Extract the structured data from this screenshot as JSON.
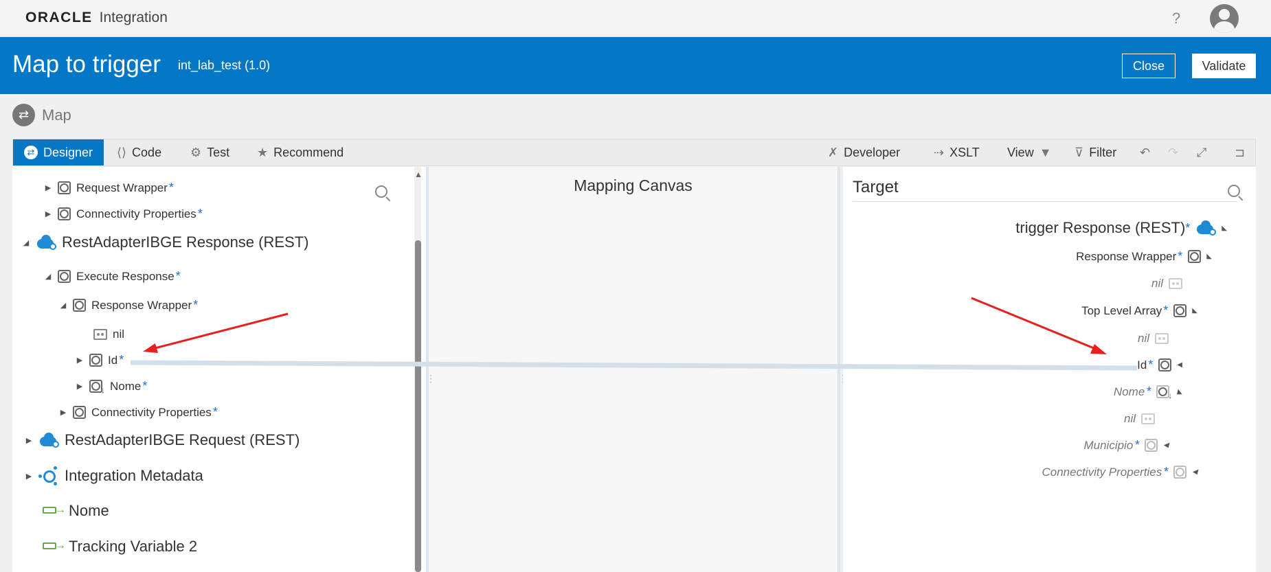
{
  "app": {
    "brand": "ORACLE",
    "product": "Integration",
    "help": "?"
  },
  "header": {
    "title": "Map to trigger",
    "subtitle": "int_lab_test (1.0)",
    "close_label": "Close",
    "validate_label": "Validate"
  },
  "crumb": {
    "label": "Map"
  },
  "toolbar": {
    "designer": "Designer",
    "code": "Code",
    "test": "Test",
    "recommend": "Recommend",
    "developer": "Developer",
    "xslt": "XSLT",
    "view": "View",
    "filter": "Filter"
  },
  "source": {
    "request_wrapper": "Request Wrapper",
    "connectivity_properties_1": "Connectivity Properties",
    "rest_response": "RestAdapterIBGE Response (REST)",
    "execute_response": "Execute Response",
    "response_wrapper": "Response Wrapper",
    "nil": "nil",
    "id": "Id",
    "nome": "Nome",
    "connectivity_properties_2": "Connectivity Properties",
    "rest_request": "RestAdapterIBGE Request (REST)",
    "integration_metadata": "Integration Metadata",
    "var_nome": "Nome",
    "tracking_variable": "Tracking Variable 2",
    "required_marker": "*"
  },
  "canvas": {
    "title": "Mapping Canvas"
  },
  "target": {
    "title": "Target",
    "trigger_response": "trigger Response (REST)",
    "response_wrapper": "Response Wrapper",
    "nil_1": "nil",
    "top_level_array": "Top Level Array",
    "nil_2": "nil",
    "id": "Id",
    "nome": "Nome",
    "nil_3": "nil",
    "municipio": "Municipio",
    "connectivity_properties": "Connectivity Properties"
  },
  "colors": {
    "header_blue": "#0577c7",
    "required_star": "#1f6fd0",
    "annotation_arrow": "#e8201d",
    "mapping_line": "#d4dfe8"
  }
}
